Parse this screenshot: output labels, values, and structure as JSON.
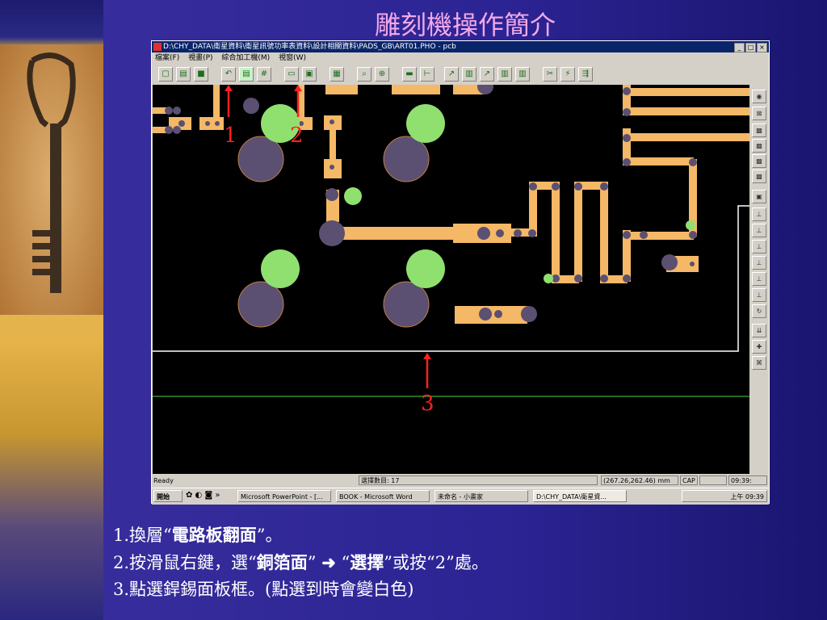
{
  "slide": {
    "title": "雕刻機操作簡介"
  },
  "window": {
    "title": "D:\\CHY_DATA\\衛星資料\\衛星訊號功率表資料\\設計相關資料\\PADS_GB\\ART01.PHO - pcb",
    "controls": [
      "_",
      "□",
      "×"
    ]
  },
  "menu": [
    "檔案(F)",
    "視畫(P)",
    "綜合加工機(M)",
    "視窗(W)"
  ],
  "annotations": {
    "a1": "1",
    "a2": "2",
    "a3": "3"
  },
  "status": {
    "left": "Ready",
    "selected": "選擇數目: 17",
    "coords": "(267.26,262.46) mm",
    "cap": "CAP",
    "time": "09:39:"
  },
  "taskbar": {
    "start": "開始",
    "tasks": [
      "Microsoft PowerPoint - [...",
      "BOOK - Microsoft Word",
      "未命名 - 小畫家",
      "D:\\CHY_DATA\\衛星資..."
    ],
    "clock": "上午 09:39"
  },
  "notes": {
    "line1_prefix": "1.換層",
    "line1_q": "電路板翻面",
    "line2_prefix": "2.按滑鼠右鍵，選",
    "line2_q1": "銅箔面",
    "line2_arrow": "➜",
    "line2_q2": "選擇",
    "line2_mid": "或按",
    "line2_q3": "2",
    "line2_end": "處。",
    "line3": "3.點選銲錫面板框。(點選到時會變白色)"
  },
  "colors": {
    "trace": "#f4b866",
    "pad": "#5b4f72",
    "green": "#90e070",
    "arrow": "#ff2020"
  }
}
